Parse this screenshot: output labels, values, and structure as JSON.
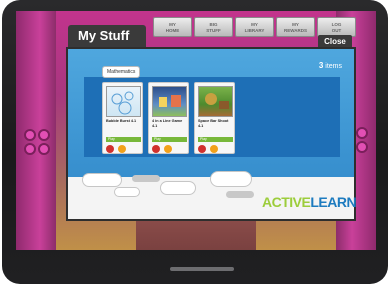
{
  "nav": {
    "items": [
      {
        "line1": "MY",
        "line2": "HOME"
      },
      {
        "line1": "BIG",
        "line2": "STUFF"
      },
      {
        "line1": "MY",
        "line2": "LIBRARY"
      },
      {
        "line1": "MY",
        "line2": "REWARDS"
      },
      {
        "line1": "LOG",
        "line2": "OUT"
      }
    ]
  },
  "dialog": {
    "title": "My Stuff",
    "close_label": "Close",
    "items_count": "3",
    "items_label": "items",
    "shelf_label": "Mathematics",
    "cards": [
      {
        "title": "Bubble Burst 4.1",
        "open_label": "Play"
      },
      {
        "title": "4 in a Line Game 4.1",
        "open_label": "Play"
      },
      {
        "title": "Space Bar Shoot 4.1",
        "open_label": "Play"
      }
    ]
  },
  "logo": {
    "part1": "ACTIVE",
    "part2": "LEARN"
  },
  "colors": {
    "dialog_blue": "#2e86c8",
    "shelf_blue": "#1e6fb6",
    "play_green": "#78b83a",
    "logo_green": "#9ccd3b",
    "logo_blue": "#1d7bbf"
  }
}
